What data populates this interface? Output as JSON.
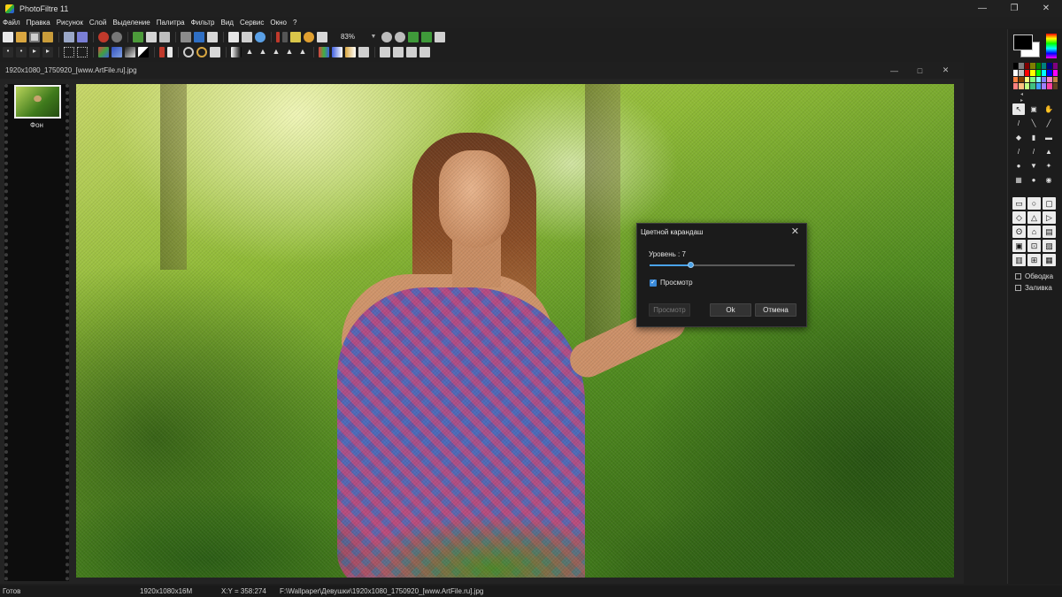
{
  "app": {
    "title": "PhotoFiltre 11"
  },
  "window_controls": {
    "minimize": "—",
    "maximize": "❐",
    "close": "✕"
  },
  "menu": [
    "Файл",
    "Правка",
    "Рисунок",
    "Слой",
    "Выделение",
    "Палитра",
    "Фильтр",
    "Вид",
    "Сервис",
    "Окно",
    "?"
  ],
  "toolbar": {
    "zoom": "83%",
    "icons_row1": [
      "new-file-icon",
      "open-file-icon",
      "save-icon",
      "print-icon",
      "scan-icon",
      "undo-icon",
      "redo-icon",
      "copy-icon",
      "paste-icon",
      "paste-new-icon",
      "crop-icon",
      "resize-icon",
      "rotate-icon",
      "text-icon",
      "find-icon",
      "color-picker-icon",
      "magic-wand-icon",
      "filter-icon",
      "gallery-icon"
    ],
    "icons_row2": [
      "arrow-icon",
      "select-icon",
      "move-icon",
      "rect-select-icon",
      "grid-icon",
      "shadow-icon",
      "contrast-icon",
      "brightness-icon",
      "levels-icon",
      "hue-icon",
      "gradient-icon",
      "sharpen-icon",
      "blur-icon"
    ]
  },
  "document": {
    "title": "1920x1080_1750920_[www.ArtFile.ru].jpg",
    "layers": [
      {
        "name": "Фон"
      }
    ]
  },
  "dialog": {
    "title": "Цветной карандаш",
    "level_label": "Уровень : 7",
    "level_fraction": 0.28,
    "preview_check_label": "Просмотр",
    "preview_checked": true,
    "preview_button": "Просмотр",
    "ok_button": "Ok",
    "cancel_button": "Отмена"
  },
  "right_panel": {
    "palette_colors": [
      "#000000",
      "#808080",
      "#800000",
      "#808000",
      "#008000",
      "#008080",
      "#000080",
      "#800080",
      "#ffffff",
      "#c0c0c0",
      "#ff0000",
      "#ffff00",
      "#00ff00",
      "#00ffff",
      "#0000ff",
      "#ff00ff",
      "#ff8040",
      "#804000",
      "#ffff80",
      "#80ff80",
      "#80ffff",
      "#8080ff",
      "#ff80c0",
      "#c08040",
      "#ff8080",
      "#ffc080",
      "#c0ff80",
      "#40c080",
      "#40a0ff",
      "#a080ff",
      "#ff40a0",
      "#604020"
    ],
    "outline_label": "Обводка",
    "fill_label": "Заливка"
  },
  "status": {
    "state": "Готов",
    "size": "1920x1080x16M",
    "coords": "X:Y = 358:274",
    "path": "F:\\Wallpaper\\Девушки\\1920x1080_1750920_[www.ArtFile.ru].jpg"
  }
}
